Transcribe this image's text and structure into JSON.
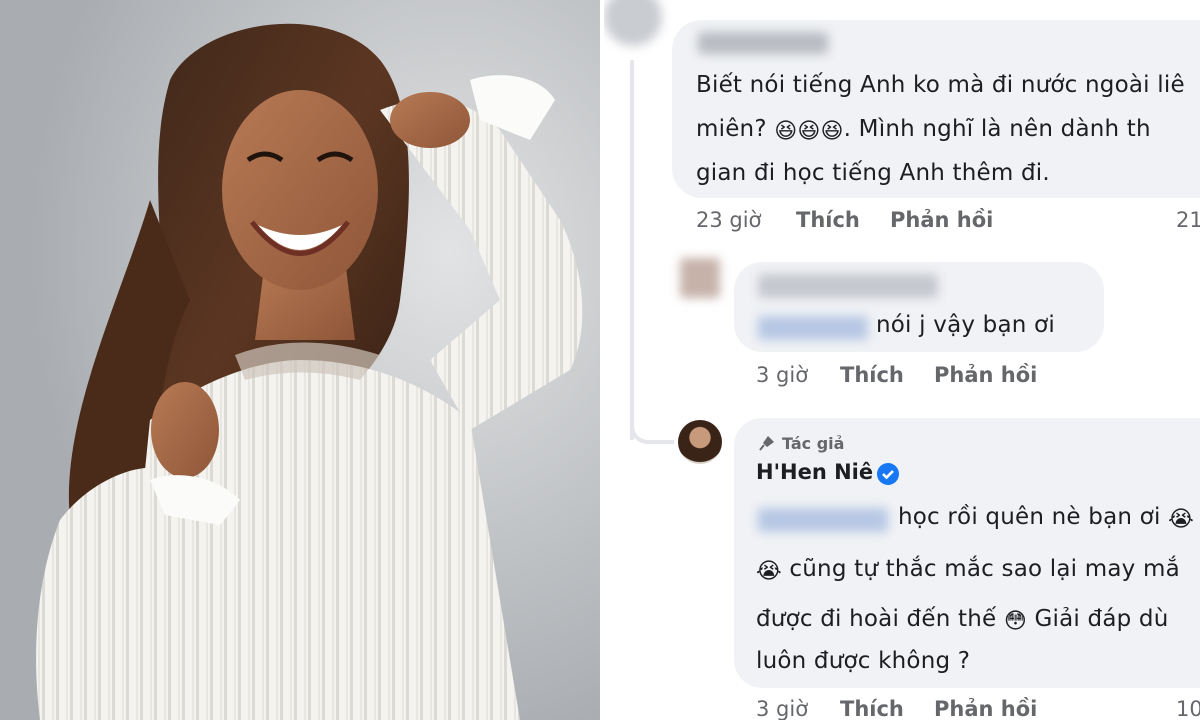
{
  "colors": {
    "bubble_bg": "#f0f2f5",
    "meta_text": "#65676b",
    "body_text": "#1c1e21",
    "verified": "#1877f2"
  },
  "photo": {
    "subject": "woman in white pleated top smiling, hand in hair"
  },
  "comment1": {
    "line1": "Biết nói tiếng Anh ko mà đi nước ngoài liê",
    "line2_a": "miên?",
    "line2_emoji": "😆😆😆",
    "line2_b": ". Mình nghĩ là nên dành th",
    "line3": "gian đi học tiếng Anh thêm đi.",
    "time": "23 giờ",
    "like": "Thích",
    "reply": "Phản hồi",
    "count": "21"
  },
  "reply1": {
    "text": "nói j vậy bạn ơi",
    "time": "3 giờ",
    "like": "Thích",
    "reply": "Phản hồi"
  },
  "reply2": {
    "author_badge": "Tác giả",
    "author_icon": "microphone-icon",
    "author_name": "H'Hen Niê",
    "verified_icon": "verified-check-icon",
    "line1": "học rồi quên nè bạn ơi",
    "line1_emoji": "😭",
    "line2_emoji": "😭",
    "line2": " cũng tự thắc mắc sao lại may mắ",
    "line3_a": "được đi hoài đến thế ",
    "line3_emoji": "😳",
    "line3_b": " Giải đáp dù",
    "line4": "luôn được không ?",
    "time": "3 giờ",
    "like": "Thích",
    "reply": "Phản hồi",
    "count": "10"
  }
}
